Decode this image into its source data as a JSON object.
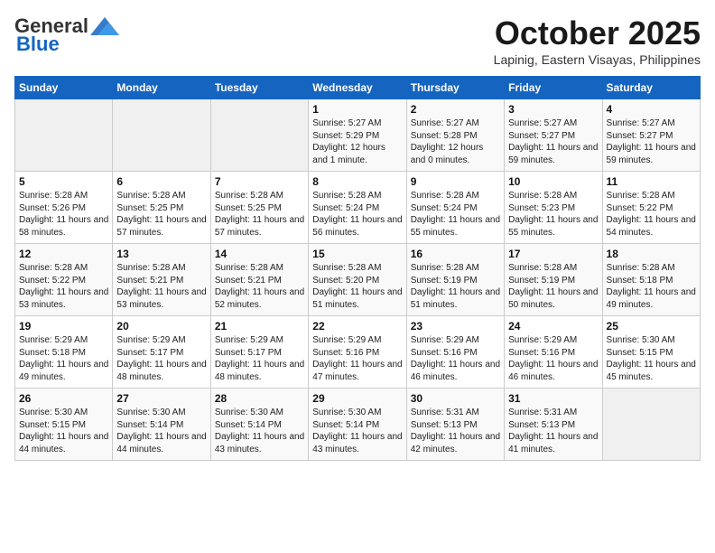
{
  "header": {
    "logo_general": "General",
    "logo_blue": "Blue",
    "month_title": "October 2025",
    "subtitle": "Lapinig, Eastern Visayas, Philippines"
  },
  "weekdays": [
    "Sunday",
    "Monday",
    "Tuesday",
    "Wednesday",
    "Thursday",
    "Friday",
    "Saturday"
  ],
  "weeks": [
    [
      {
        "day": "",
        "sunrise": "",
        "sunset": "",
        "daylight": ""
      },
      {
        "day": "",
        "sunrise": "",
        "sunset": "",
        "daylight": ""
      },
      {
        "day": "",
        "sunrise": "",
        "sunset": "",
        "daylight": ""
      },
      {
        "day": "1",
        "sunrise": "Sunrise: 5:27 AM",
        "sunset": "Sunset: 5:29 PM",
        "daylight": "Daylight: 12 hours and 1 minute."
      },
      {
        "day": "2",
        "sunrise": "Sunrise: 5:27 AM",
        "sunset": "Sunset: 5:28 PM",
        "daylight": "Daylight: 12 hours and 0 minutes."
      },
      {
        "day": "3",
        "sunrise": "Sunrise: 5:27 AM",
        "sunset": "Sunset: 5:27 PM",
        "daylight": "Daylight: 11 hours and 59 minutes."
      },
      {
        "day": "4",
        "sunrise": "Sunrise: 5:27 AM",
        "sunset": "Sunset: 5:27 PM",
        "daylight": "Daylight: 11 hours and 59 minutes."
      }
    ],
    [
      {
        "day": "5",
        "sunrise": "Sunrise: 5:28 AM",
        "sunset": "Sunset: 5:26 PM",
        "daylight": "Daylight: 11 hours and 58 minutes."
      },
      {
        "day": "6",
        "sunrise": "Sunrise: 5:28 AM",
        "sunset": "Sunset: 5:25 PM",
        "daylight": "Daylight: 11 hours and 57 minutes."
      },
      {
        "day": "7",
        "sunrise": "Sunrise: 5:28 AM",
        "sunset": "Sunset: 5:25 PM",
        "daylight": "Daylight: 11 hours and 57 minutes."
      },
      {
        "day": "8",
        "sunrise": "Sunrise: 5:28 AM",
        "sunset": "Sunset: 5:24 PM",
        "daylight": "Daylight: 11 hours and 56 minutes."
      },
      {
        "day": "9",
        "sunrise": "Sunrise: 5:28 AM",
        "sunset": "Sunset: 5:24 PM",
        "daylight": "Daylight: 11 hours and 55 minutes."
      },
      {
        "day": "10",
        "sunrise": "Sunrise: 5:28 AM",
        "sunset": "Sunset: 5:23 PM",
        "daylight": "Daylight: 11 hours and 55 minutes."
      },
      {
        "day": "11",
        "sunrise": "Sunrise: 5:28 AM",
        "sunset": "Sunset: 5:22 PM",
        "daylight": "Daylight: 11 hours and 54 minutes."
      }
    ],
    [
      {
        "day": "12",
        "sunrise": "Sunrise: 5:28 AM",
        "sunset": "Sunset: 5:22 PM",
        "daylight": "Daylight: 11 hours and 53 minutes."
      },
      {
        "day": "13",
        "sunrise": "Sunrise: 5:28 AM",
        "sunset": "Sunset: 5:21 PM",
        "daylight": "Daylight: 11 hours and 53 minutes."
      },
      {
        "day": "14",
        "sunrise": "Sunrise: 5:28 AM",
        "sunset": "Sunset: 5:21 PM",
        "daylight": "Daylight: 11 hours and 52 minutes."
      },
      {
        "day": "15",
        "sunrise": "Sunrise: 5:28 AM",
        "sunset": "Sunset: 5:20 PM",
        "daylight": "Daylight: 11 hours and 51 minutes."
      },
      {
        "day": "16",
        "sunrise": "Sunrise: 5:28 AM",
        "sunset": "Sunset: 5:19 PM",
        "daylight": "Daylight: 11 hours and 51 minutes."
      },
      {
        "day": "17",
        "sunrise": "Sunrise: 5:28 AM",
        "sunset": "Sunset: 5:19 PM",
        "daylight": "Daylight: 11 hours and 50 minutes."
      },
      {
        "day": "18",
        "sunrise": "Sunrise: 5:28 AM",
        "sunset": "Sunset: 5:18 PM",
        "daylight": "Daylight: 11 hours and 49 minutes."
      }
    ],
    [
      {
        "day": "19",
        "sunrise": "Sunrise: 5:29 AM",
        "sunset": "Sunset: 5:18 PM",
        "daylight": "Daylight: 11 hours and 49 minutes."
      },
      {
        "day": "20",
        "sunrise": "Sunrise: 5:29 AM",
        "sunset": "Sunset: 5:17 PM",
        "daylight": "Daylight: 11 hours and 48 minutes."
      },
      {
        "day": "21",
        "sunrise": "Sunrise: 5:29 AM",
        "sunset": "Sunset: 5:17 PM",
        "daylight": "Daylight: 11 hours and 48 minutes."
      },
      {
        "day": "22",
        "sunrise": "Sunrise: 5:29 AM",
        "sunset": "Sunset: 5:16 PM",
        "daylight": "Daylight: 11 hours and 47 minutes."
      },
      {
        "day": "23",
        "sunrise": "Sunrise: 5:29 AM",
        "sunset": "Sunset: 5:16 PM",
        "daylight": "Daylight: 11 hours and 46 minutes."
      },
      {
        "day": "24",
        "sunrise": "Sunrise: 5:29 AM",
        "sunset": "Sunset: 5:16 PM",
        "daylight": "Daylight: 11 hours and 46 minutes."
      },
      {
        "day": "25",
        "sunrise": "Sunrise: 5:30 AM",
        "sunset": "Sunset: 5:15 PM",
        "daylight": "Daylight: 11 hours and 45 minutes."
      }
    ],
    [
      {
        "day": "26",
        "sunrise": "Sunrise: 5:30 AM",
        "sunset": "Sunset: 5:15 PM",
        "daylight": "Daylight: 11 hours and 44 minutes."
      },
      {
        "day": "27",
        "sunrise": "Sunrise: 5:30 AM",
        "sunset": "Sunset: 5:14 PM",
        "daylight": "Daylight: 11 hours and 44 minutes."
      },
      {
        "day": "28",
        "sunrise": "Sunrise: 5:30 AM",
        "sunset": "Sunset: 5:14 PM",
        "daylight": "Daylight: 11 hours and 43 minutes."
      },
      {
        "day": "29",
        "sunrise": "Sunrise: 5:30 AM",
        "sunset": "Sunset: 5:14 PM",
        "daylight": "Daylight: 11 hours and 43 minutes."
      },
      {
        "day": "30",
        "sunrise": "Sunrise: 5:31 AM",
        "sunset": "Sunset: 5:13 PM",
        "daylight": "Daylight: 11 hours and 42 minutes."
      },
      {
        "day": "31",
        "sunrise": "Sunrise: 5:31 AM",
        "sunset": "Sunset: 5:13 PM",
        "daylight": "Daylight: 11 hours and 41 minutes."
      },
      {
        "day": "",
        "sunrise": "",
        "sunset": "",
        "daylight": ""
      }
    ]
  ]
}
